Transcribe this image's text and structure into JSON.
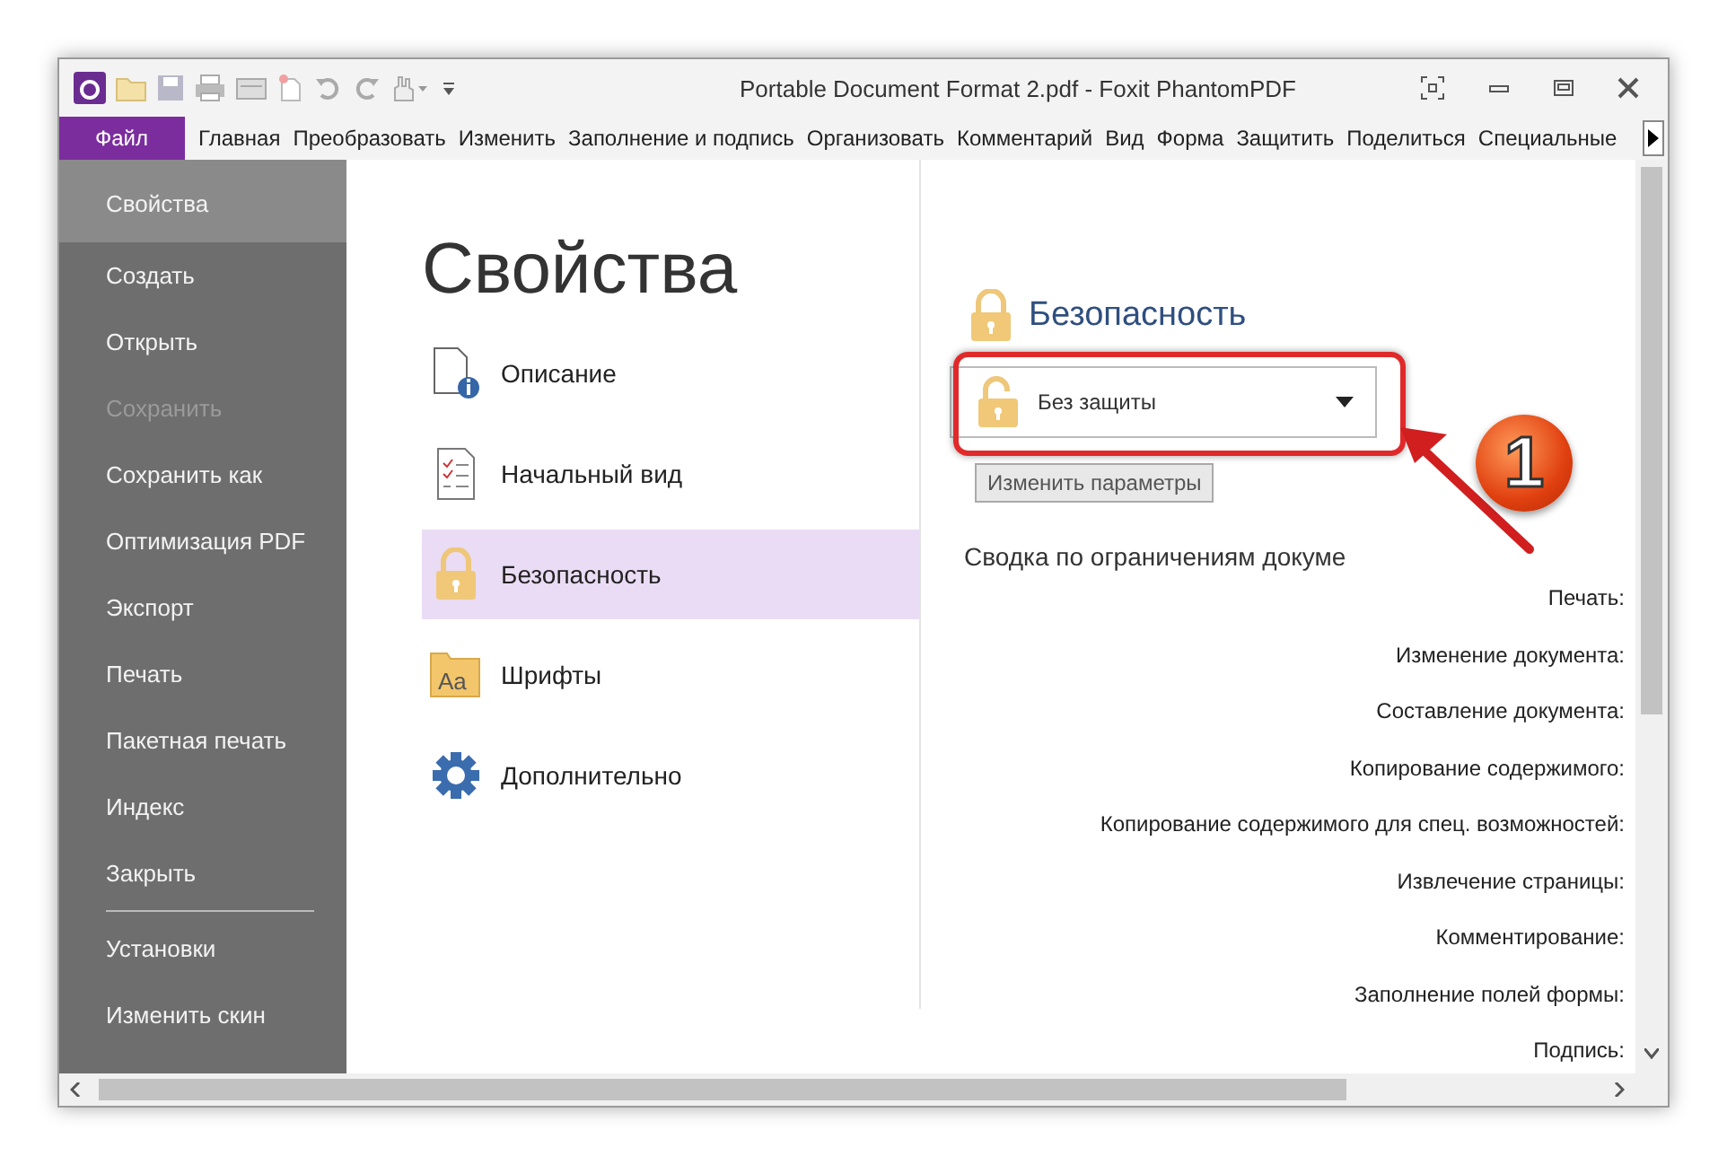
{
  "window": {
    "title": "Portable Document Format 2.pdf - Foxit PhantomPDF"
  },
  "ribbon_tabs": [
    {
      "label": "Файл",
      "selected": true
    },
    {
      "label": "Главная",
      "selected": false
    },
    {
      "label": "Преобразовать",
      "selected": false
    },
    {
      "label": "Изменить",
      "selected": false
    },
    {
      "label": "Заполнение и подпись",
      "selected": false
    },
    {
      "label": "Организовать",
      "selected": false
    },
    {
      "label": "Комментарий",
      "selected": false
    },
    {
      "label": "Вид",
      "selected": false
    },
    {
      "label": "Форма",
      "selected": false
    },
    {
      "label": "Защитить",
      "selected": false
    },
    {
      "label": "Поделиться",
      "selected": false
    },
    {
      "label": "Специальные",
      "selected": false
    }
  ],
  "sidebar": {
    "items": [
      {
        "label": "Свойства",
        "selected": true,
        "disabled": false
      },
      {
        "label": "Создать",
        "selected": false,
        "disabled": false
      },
      {
        "label": "Открыть",
        "selected": false,
        "disabled": false
      },
      {
        "label": "Сохранить",
        "selected": false,
        "disabled": true
      },
      {
        "label": "Сохранить как",
        "selected": false,
        "disabled": false
      },
      {
        "label": "Оптимизация PDF",
        "selected": false,
        "disabled": false
      },
      {
        "label": "Экспорт",
        "selected": false,
        "disabled": false
      },
      {
        "label": "Печать",
        "selected": false,
        "disabled": false
      },
      {
        "label": "Пакетная печать",
        "selected": false,
        "disabled": false
      },
      {
        "label": "Индекс",
        "selected": false,
        "disabled": false
      },
      {
        "label": "Закрыть",
        "selected": false,
        "disabled": false
      }
    ],
    "settings_items": [
      {
        "label": "Установки",
        "selected": false,
        "disabled": false
      },
      {
        "label": "Изменить скин",
        "selected": false,
        "disabled": false
      }
    ]
  },
  "properties": {
    "title": "Свойства",
    "categories": [
      {
        "label": "Описание",
        "kind": "description",
        "selected": false
      },
      {
        "label": "Начальный вид",
        "kind": "initial",
        "selected": false
      },
      {
        "label": "Безопасность",
        "kind": "security",
        "selected": true
      },
      {
        "label": "Шрифты",
        "kind": "fonts",
        "selected": false,
        "icon_text": "Aa"
      },
      {
        "label": "Дополнительно",
        "kind": "advanced",
        "selected": false
      }
    ]
  },
  "security": {
    "heading": "Безопасность",
    "method": {
      "value": "Без защиты"
    },
    "change_button": "Изменить параметры",
    "summary_title": "Сводка по ограничениям докуме",
    "restrictions": [
      "Печать:",
      "Изменение документа:",
      "Составление документа:",
      "Копирование содержимого:",
      "Копирование содержимого для спец. возможностей:",
      "Извлечение страницы:",
      "Комментирование:",
      "Заполнение полей формы:",
      "Подпись:"
    ]
  },
  "annotation": {
    "badge": "1"
  }
}
